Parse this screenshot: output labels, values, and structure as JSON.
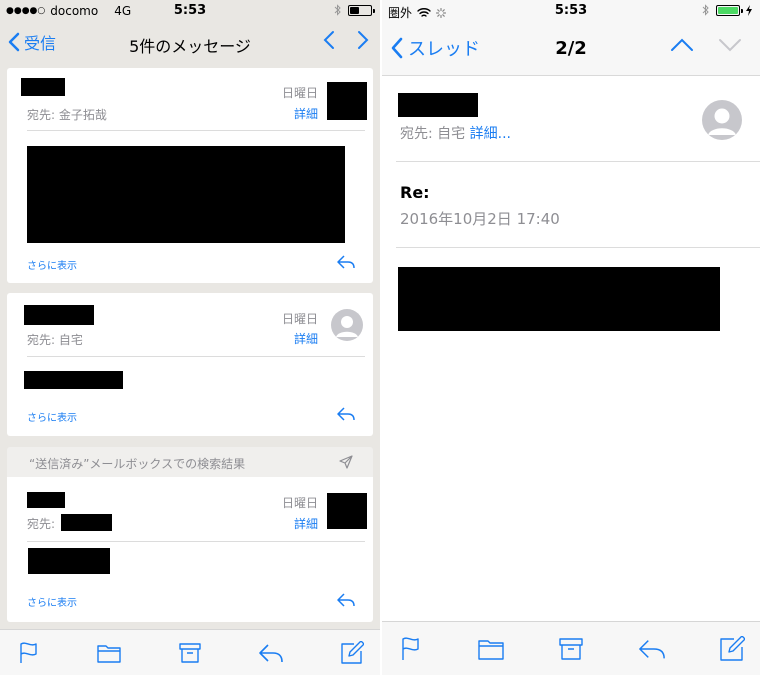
{
  "left": {
    "status": {
      "carrier": "docomo",
      "network": "4G",
      "time": "5:53",
      "signal_dots": "●●●●○"
    },
    "nav": {
      "back": "受信",
      "title": "5件のメッセージ"
    },
    "messages": [
      {
        "date": "日曜日",
        "detail": "詳細",
        "to_label": "宛先:",
        "to_value": "金子拓哉",
        "more": "さらに表示"
      },
      {
        "date": "日曜日",
        "detail": "詳細",
        "to_label": "宛先:",
        "to_value": "自宅",
        "more": "さらに表示"
      },
      {
        "date": "日曜日",
        "detail": "詳細",
        "to_label": "宛先:",
        "to_value": "",
        "more": "さらに表示"
      }
    ],
    "section_header": "“送信済み”メールボックスでの検索結果"
  },
  "right": {
    "status": {
      "carrier": "圏外",
      "time": "5:53"
    },
    "nav": {
      "back": "スレッド",
      "title": "2/2"
    },
    "to_label": "宛先:",
    "to_value": "自宅",
    "to_detail": "詳細...",
    "subject": "Re:",
    "date": "2016年10月2日 17:40"
  },
  "colors": {
    "accent": "#1a7df2",
    "battery_fill_right": "#4cd964"
  },
  "icons": [
    "flag-icon",
    "folder-icon",
    "archive-icon",
    "reply-icon",
    "compose-icon"
  ]
}
